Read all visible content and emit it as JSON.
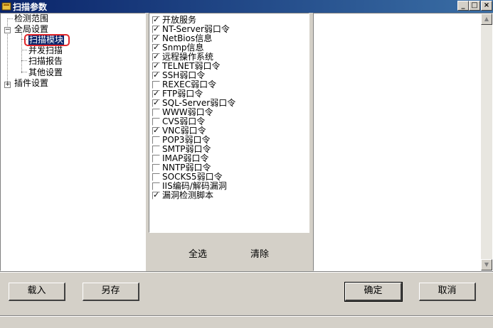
{
  "window": {
    "title": "扫描参数",
    "minimize": "_",
    "maximize": "□",
    "close": "×"
  },
  "tree": {
    "n0": "检测范围",
    "n1": "全局设置",
    "n2": "扫描模块",
    "n3": "并发扫描",
    "n4": "扫描报告",
    "n5": "其他设置",
    "n6": "插件设置",
    "expand_minus": "−",
    "expand_plus": "+"
  },
  "modules": [
    {
      "label": "开放服务",
      "checked": true
    },
    {
      "label": "NT-Server弱口令",
      "checked": true
    },
    {
      "label": "NetBios信息",
      "checked": true
    },
    {
      "label": "Snmp信息",
      "checked": true
    },
    {
      "label": "远程操作系统",
      "checked": true
    },
    {
      "label": "TELNET弱口令",
      "checked": true
    },
    {
      "label": "SSH弱口令",
      "checked": true
    },
    {
      "label": "REXEC弱口令",
      "checked": false
    },
    {
      "label": "FTP弱口令",
      "checked": true
    },
    {
      "label": "SQL-Server弱口令",
      "checked": true
    },
    {
      "label": "WWW弱口令",
      "checked": false
    },
    {
      "label": "CVS弱口令",
      "checked": false
    },
    {
      "label": "VNC弱口令",
      "checked": true
    },
    {
      "label": "POP3弱口令",
      "checked": false
    },
    {
      "label": "SMTP弱口令",
      "checked": false
    },
    {
      "label": "IMAP弱口令",
      "checked": false
    },
    {
      "label": "NNTP弱口令",
      "checked": false
    },
    {
      "label": "SOCKS5弱口令",
      "checked": false
    },
    {
      "label": "IIS编码/解码漏洞",
      "checked": false
    },
    {
      "label": "漏洞检测脚本",
      "checked": true
    }
  ],
  "module_footer": {
    "select_all": "全选",
    "clear": "清除"
  },
  "buttons": {
    "load": "载入",
    "save_as": "另存",
    "ok": "确定",
    "cancel": "取消"
  },
  "colors": {
    "title_bar": "#0a246a",
    "highlight_ring": "#e0262a",
    "face": "#d4d0c8"
  }
}
